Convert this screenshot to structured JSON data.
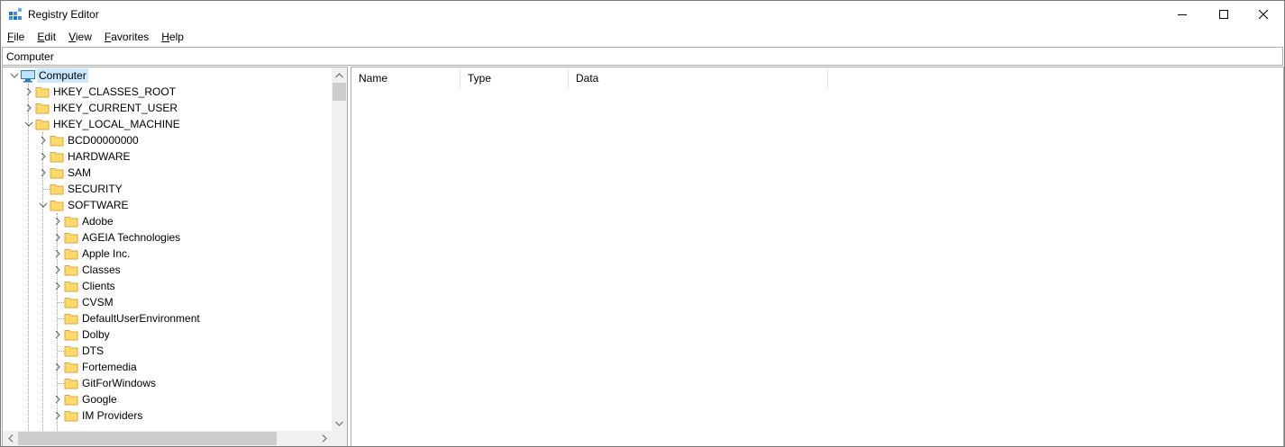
{
  "window": {
    "title": "Registry Editor"
  },
  "menu": [
    "File",
    "Edit",
    "View",
    "Favorites",
    "Help"
  ],
  "address": "Computer",
  "tree": [
    {
      "label": "Computer",
      "level": 0,
      "toggle": "expanded",
      "selected": true
    },
    {
      "label": "HKEY_CLASSES_ROOT",
      "level": 1,
      "toggle": "collapsed"
    },
    {
      "label": "HKEY_CURRENT_USER",
      "level": 1,
      "toggle": "collapsed"
    },
    {
      "label": "HKEY_LOCAL_MACHINE",
      "level": 1,
      "toggle": "expanded"
    },
    {
      "label": "BCD00000000",
      "level": 2,
      "toggle": "collapsed"
    },
    {
      "label": "HARDWARE",
      "level": 2,
      "toggle": "collapsed"
    },
    {
      "label": "SAM",
      "level": 2,
      "toggle": "collapsed"
    },
    {
      "label": "SECURITY",
      "level": 2,
      "toggle": "none"
    },
    {
      "label": "SOFTWARE",
      "level": 2,
      "toggle": "expanded"
    },
    {
      "label": "Adobe",
      "level": 3,
      "toggle": "collapsed"
    },
    {
      "label": "AGEIA Technologies",
      "level": 3,
      "toggle": "collapsed"
    },
    {
      "label": "Apple Inc.",
      "level": 3,
      "toggle": "collapsed"
    },
    {
      "label": "Classes",
      "level": 3,
      "toggle": "collapsed"
    },
    {
      "label": "Clients",
      "level": 3,
      "toggle": "collapsed"
    },
    {
      "label": "CVSM",
      "level": 3,
      "toggle": "none"
    },
    {
      "label": "DefaultUserEnvironment",
      "level": 3,
      "toggle": "none"
    },
    {
      "label": "Dolby",
      "level": 3,
      "toggle": "collapsed"
    },
    {
      "label": "DTS",
      "level": 3,
      "toggle": "none"
    },
    {
      "label": "Fortemedia",
      "level": 3,
      "toggle": "collapsed"
    },
    {
      "label": "GitForWindows",
      "level": 3,
      "toggle": "none"
    },
    {
      "label": "Google",
      "level": 3,
      "toggle": "collapsed"
    },
    {
      "label": "IM Providers",
      "level": 3,
      "toggle": "collapsed"
    }
  ],
  "columns": [
    "Name",
    "Type",
    "Data"
  ],
  "colors": {
    "selection": "#cce8ff",
    "folder": "#ffd969",
    "folder_edge": "#d9a93a",
    "border": "#adadad",
    "scrollbar_track": "#f0f0f0",
    "scrollbar_thumb": "#cdcdcd"
  },
  "icons": {
    "app": "registry-editor-icon",
    "minimize": "minimize-icon",
    "maximize": "maximize-icon",
    "close": "close-icon",
    "computer": "computer-icon",
    "folder": "folder-icon",
    "expand": "chevron-right-icon",
    "collapse": "chevron-down-icon"
  }
}
